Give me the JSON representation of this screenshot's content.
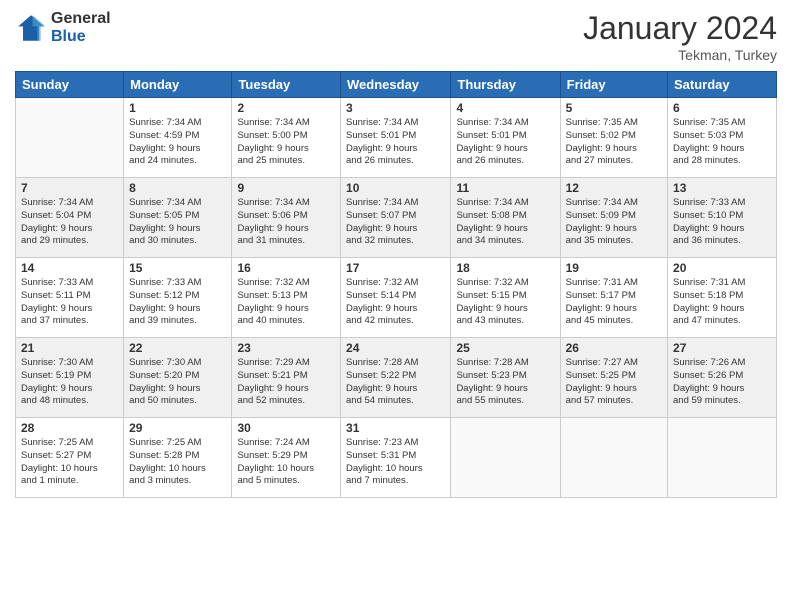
{
  "header": {
    "logo_general": "General",
    "logo_blue": "Blue",
    "month_title": "January 2024",
    "location": "Tekman, Turkey"
  },
  "days_of_week": [
    "Sunday",
    "Monday",
    "Tuesday",
    "Wednesday",
    "Thursday",
    "Friday",
    "Saturday"
  ],
  "weeks": [
    [
      {
        "day": "",
        "info": ""
      },
      {
        "day": "1",
        "info": "Sunrise: 7:34 AM\nSunset: 4:59 PM\nDaylight: 9 hours\nand 24 minutes."
      },
      {
        "day": "2",
        "info": "Sunrise: 7:34 AM\nSunset: 5:00 PM\nDaylight: 9 hours\nand 25 minutes."
      },
      {
        "day": "3",
        "info": "Sunrise: 7:34 AM\nSunset: 5:01 PM\nDaylight: 9 hours\nand 26 minutes."
      },
      {
        "day": "4",
        "info": "Sunrise: 7:34 AM\nSunset: 5:01 PM\nDaylight: 9 hours\nand 26 minutes."
      },
      {
        "day": "5",
        "info": "Sunrise: 7:35 AM\nSunset: 5:02 PM\nDaylight: 9 hours\nand 27 minutes."
      },
      {
        "day": "6",
        "info": "Sunrise: 7:35 AM\nSunset: 5:03 PM\nDaylight: 9 hours\nand 28 minutes."
      }
    ],
    [
      {
        "day": "7",
        "info": "Sunrise: 7:34 AM\nSunset: 5:04 PM\nDaylight: 9 hours\nand 29 minutes."
      },
      {
        "day": "8",
        "info": "Sunrise: 7:34 AM\nSunset: 5:05 PM\nDaylight: 9 hours\nand 30 minutes."
      },
      {
        "day": "9",
        "info": "Sunrise: 7:34 AM\nSunset: 5:06 PM\nDaylight: 9 hours\nand 31 minutes."
      },
      {
        "day": "10",
        "info": "Sunrise: 7:34 AM\nSunset: 5:07 PM\nDaylight: 9 hours\nand 32 minutes."
      },
      {
        "day": "11",
        "info": "Sunrise: 7:34 AM\nSunset: 5:08 PM\nDaylight: 9 hours\nand 34 minutes."
      },
      {
        "day": "12",
        "info": "Sunrise: 7:34 AM\nSunset: 5:09 PM\nDaylight: 9 hours\nand 35 minutes."
      },
      {
        "day": "13",
        "info": "Sunrise: 7:33 AM\nSunset: 5:10 PM\nDaylight: 9 hours\nand 36 minutes."
      }
    ],
    [
      {
        "day": "14",
        "info": "Sunrise: 7:33 AM\nSunset: 5:11 PM\nDaylight: 9 hours\nand 37 minutes."
      },
      {
        "day": "15",
        "info": "Sunrise: 7:33 AM\nSunset: 5:12 PM\nDaylight: 9 hours\nand 39 minutes."
      },
      {
        "day": "16",
        "info": "Sunrise: 7:32 AM\nSunset: 5:13 PM\nDaylight: 9 hours\nand 40 minutes."
      },
      {
        "day": "17",
        "info": "Sunrise: 7:32 AM\nSunset: 5:14 PM\nDaylight: 9 hours\nand 42 minutes."
      },
      {
        "day": "18",
        "info": "Sunrise: 7:32 AM\nSunset: 5:15 PM\nDaylight: 9 hours\nand 43 minutes."
      },
      {
        "day": "19",
        "info": "Sunrise: 7:31 AM\nSunset: 5:17 PM\nDaylight: 9 hours\nand 45 minutes."
      },
      {
        "day": "20",
        "info": "Sunrise: 7:31 AM\nSunset: 5:18 PM\nDaylight: 9 hours\nand 47 minutes."
      }
    ],
    [
      {
        "day": "21",
        "info": "Sunrise: 7:30 AM\nSunset: 5:19 PM\nDaylight: 9 hours\nand 48 minutes."
      },
      {
        "day": "22",
        "info": "Sunrise: 7:30 AM\nSunset: 5:20 PM\nDaylight: 9 hours\nand 50 minutes."
      },
      {
        "day": "23",
        "info": "Sunrise: 7:29 AM\nSunset: 5:21 PM\nDaylight: 9 hours\nand 52 minutes."
      },
      {
        "day": "24",
        "info": "Sunrise: 7:28 AM\nSunset: 5:22 PM\nDaylight: 9 hours\nand 54 minutes."
      },
      {
        "day": "25",
        "info": "Sunrise: 7:28 AM\nSunset: 5:23 PM\nDaylight: 9 hours\nand 55 minutes."
      },
      {
        "day": "26",
        "info": "Sunrise: 7:27 AM\nSunset: 5:25 PM\nDaylight: 9 hours\nand 57 minutes."
      },
      {
        "day": "27",
        "info": "Sunrise: 7:26 AM\nSunset: 5:26 PM\nDaylight: 9 hours\nand 59 minutes."
      }
    ],
    [
      {
        "day": "28",
        "info": "Sunrise: 7:25 AM\nSunset: 5:27 PM\nDaylight: 10 hours\nand 1 minute."
      },
      {
        "day": "29",
        "info": "Sunrise: 7:25 AM\nSunset: 5:28 PM\nDaylight: 10 hours\nand 3 minutes."
      },
      {
        "day": "30",
        "info": "Sunrise: 7:24 AM\nSunset: 5:29 PM\nDaylight: 10 hours\nand 5 minutes."
      },
      {
        "day": "31",
        "info": "Sunrise: 7:23 AM\nSunset: 5:31 PM\nDaylight: 10 hours\nand 7 minutes."
      },
      {
        "day": "",
        "info": ""
      },
      {
        "day": "",
        "info": ""
      },
      {
        "day": "",
        "info": ""
      }
    ]
  ]
}
